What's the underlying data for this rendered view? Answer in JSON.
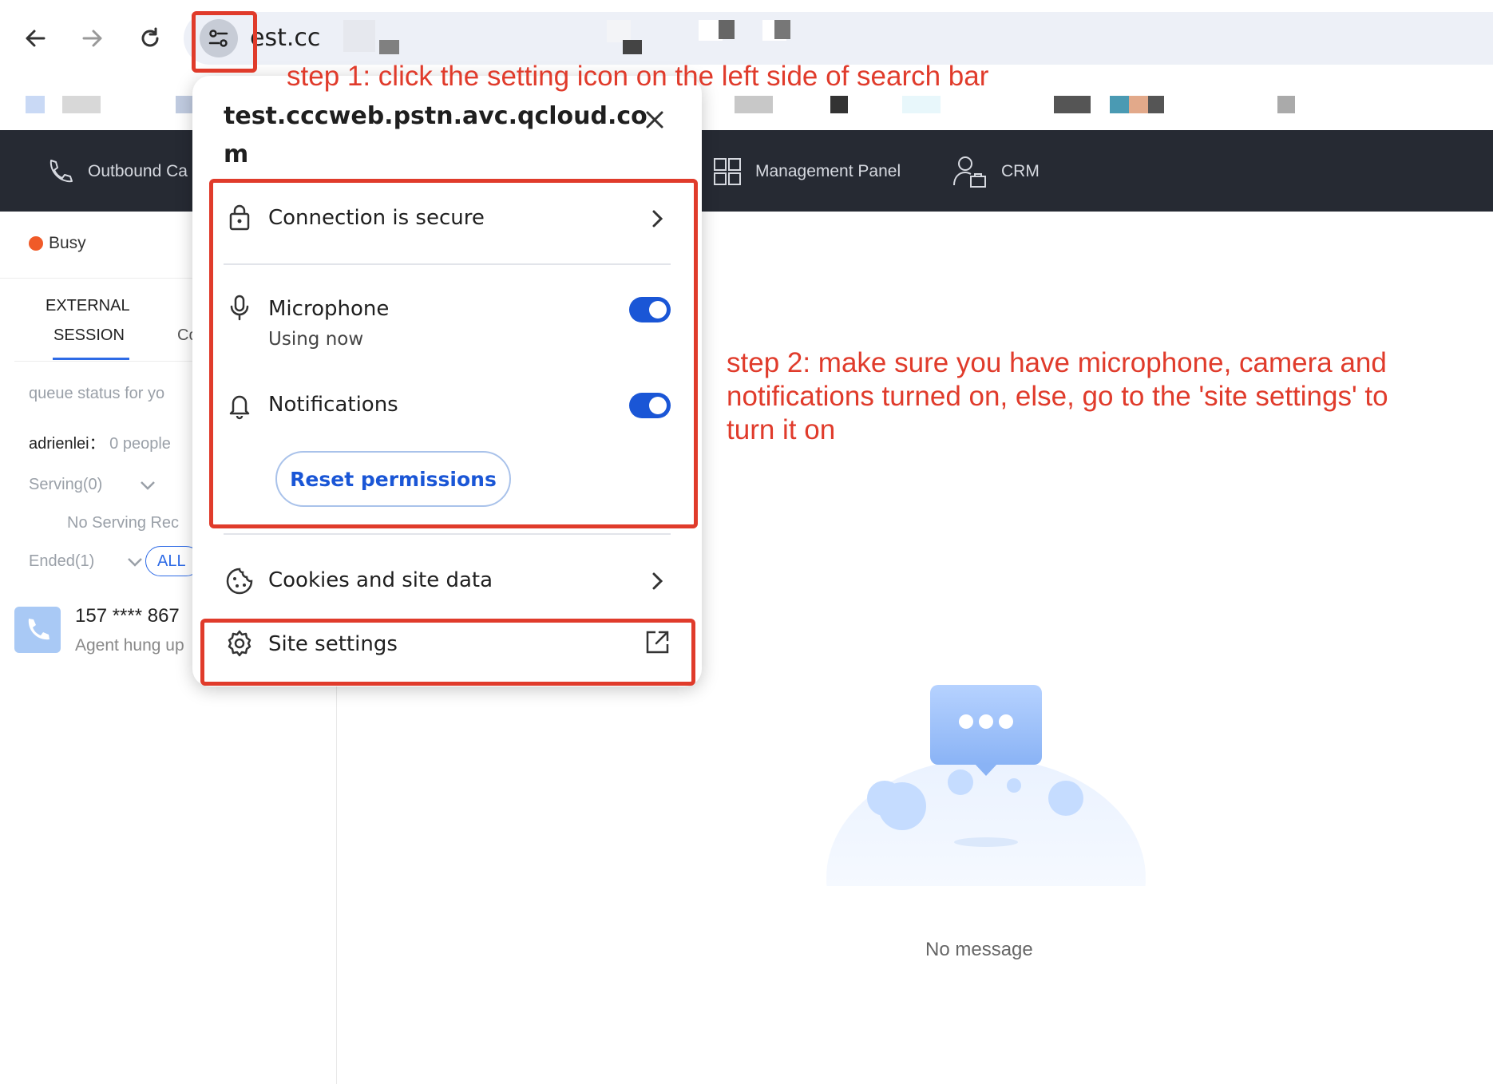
{
  "browser": {
    "url_partial": "est.cc",
    "back_icon": "arrow-left-icon",
    "forward_icon": "arrow-right-icon",
    "reload_icon": "reload-icon",
    "site_info_icon": "tune-icon"
  },
  "app_header": {
    "items": [
      {
        "label": "Outbound Ca",
        "icon": "phone-icon"
      },
      {
        "label": "Management Panel",
        "icon": "grid-icon"
      },
      {
        "label": "CRM",
        "icon": "user-briefcase-icon"
      }
    ]
  },
  "left_panel": {
    "status": "Busy",
    "status_color": "#f05a28",
    "tab_line1": "EXTERNAL",
    "tab_line2": "SESSION",
    "tab_next": "Co",
    "queue_label": "queue status for yo",
    "queue_user": "adrienlei",
    "queue_sep": "：",
    "queue_count": "0 people",
    "serving": "Serving(0)",
    "no_serving": "No Serving Rec",
    "ended": "Ended(1)",
    "filter": "ALL",
    "call_number": "157 **** 867",
    "call_status": "Agent hung up"
  },
  "popup": {
    "domain_line1": "test.cccweb.pstn.avc.qcloud.co",
    "domain_line2": "m",
    "connection": "Connection is secure",
    "microphone": "Microphone",
    "microphone_status": "Using now",
    "notifications": "Notifications",
    "reset": "Reset permissions",
    "cookies": "Cookies and site data",
    "site_settings": "Site settings",
    "microphone_on": true,
    "notifications_on": true
  },
  "main": {
    "empty_text": "No message"
  },
  "annotations": {
    "step1": "step 1: click the setting icon on the left side of search bar",
    "step2_line1": "step 2: make sure you have microphone, camera and",
    "step2_line2": "notifications turned on, else, go to the 'site settings' to",
    "step2_line3": "turn it on",
    "color": "#e03b2b"
  }
}
